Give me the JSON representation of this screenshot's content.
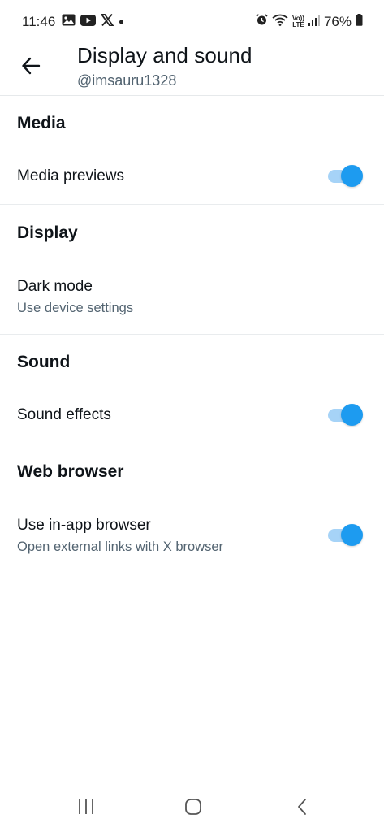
{
  "status_bar": {
    "time": "11:46",
    "battery": "76%",
    "icons_left": [
      "gallery-icon",
      "youtube-icon",
      "x-logo-icon",
      "dot"
    ],
    "icons_right": [
      "alarm-icon",
      "wifi-icon",
      "volte-icon",
      "signal-icon",
      "battery-icon"
    ],
    "volte_top": "Vo))",
    "volte_bottom": "LTE"
  },
  "header": {
    "title": "Display and sound",
    "subtitle": "@imsauru1328"
  },
  "sections": {
    "media": {
      "title": "Media",
      "media_previews": {
        "label": "Media previews",
        "enabled": true
      }
    },
    "display": {
      "title": "Display",
      "dark_mode": {
        "label": "Dark mode",
        "sub": "Use device settings"
      }
    },
    "sound": {
      "title": "Sound",
      "sound_effects": {
        "label": "Sound effects",
        "enabled": true
      }
    },
    "web_browser": {
      "title": "Web browser",
      "in_app_browser": {
        "label": "Use in-app browser",
        "sub": "Open external links with X browser",
        "enabled": true
      }
    }
  },
  "colors": {
    "accent": "#1d9bf0",
    "accent_track": "#a6d3f7",
    "secondary_text": "#536471",
    "divider": "#e9ecee"
  }
}
